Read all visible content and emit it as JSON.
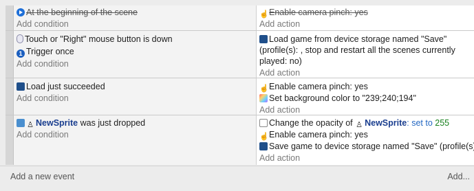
{
  "events": [
    {
      "conditions": [
        {
          "icon": "scene-start-icon",
          "text": "At the beginning of the scene",
          "disabled": true
        }
      ],
      "add_condition": "Add condition",
      "actions": [
        {
          "icon": "camera-pinch-icon",
          "text": "Enable camera pinch: yes",
          "disabled": true
        }
      ],
      "add_action": "Add action"
    },
    {
      "conditions": [
        {
          "icon": "mouse-icon",
          "text": "Touch or \"Right\" mouse button is down"
        },
        {
          "icon": "trigger-once-icon",
          "text": "Trigger once"
        }
      ],
      "add_condition": "Add condition",
      "actions": [
        {
          "icon": "storage-icon",
          "text": "Load game from device storage named \"Save\" (profile(s): , stop and restart all the scenes currently played: no)"
        }
      ],
      "add_action": "Add action"
    },
    {
      "conditions": [
        {
          "icon": "storage-icon",
          "text": "Load just succeeded"
        }
      ],
      "add_condition": "Add condition",
      "actions": [
        {
          "icon": "camera-pinch-icon",
          "text": "Enable camera pinch: yes"
        },
        {
          "icon": "background-color-icon",
          "text": "Set background color to \"239;240;194\""
        }
      ],
      "add_action": "Add action"
    },
    {
      "conditions": [
        {
          "icon": "drag-icon",
          "object": "NewSprite",
          "text": "was just dropped"
        }
      ],
      "add_condition": "Add condition",
      "actions": [
        {
          "icon": "opacity-icon",
          "prefix": "Change the opacity of",
          "object": "NewSprite",
          "op": ": set to",
          "value": "255"
        },
        {
          "icon": "camera-pinch-icon",
          "text": "Enable camera pinch: yes"
        },
        {
          "icon": "storage-icon",
          "text": "Save game to device storage named \"Save\" (profile(s): )"
        }
      ],
      "add_action": "Add action"
    }
  ],
  "footer": {
    "add_event": "Add a new event",
    "add_more": "Add..."
  }
}
